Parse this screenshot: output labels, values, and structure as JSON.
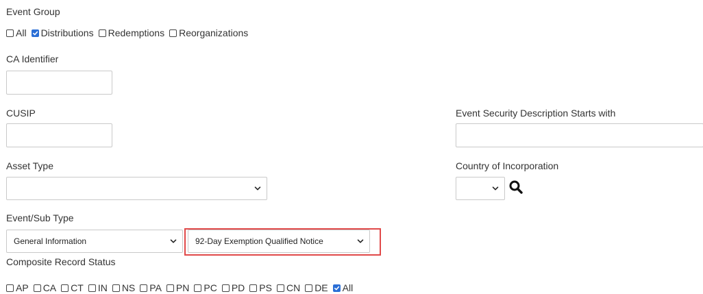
{
  "event_group": {
    "label": "Event Group",
    "options": [
      {
        "label": "All",
        "checked": false
      },
      {
        "label": "Distributions",
        "checked": true
      },
      {
        "label": "Redemptions",
        "checked": false
      },
      {
        "label": "Reorganizations",
        "checked": false
      }
    ]
  },
  "ca_identifier": {
    "label": "CA Identifier",
    "value": ""
  },
  "cusip": {
    "label": "CUSIP",
    "value": ""
  },
  "event_security_description": {
    "label": "Event Security Description Starts with",
    "value": ""
  },
  "asset_type": {
    "label": "Asset Type",
    "selected": ""
  },
  "country_of_incorporation": {
    "label": "Country of Incorporation",
    "selected": ""
  },
  "event_sub_type": {
    "label": "Event/Sub Type",
    "event_type_selected": "General Information",
    "sub_type_selected": "92-Day Exemption Qualified Notice"
  },
  "composite_record_status": {
    "label": "Composite Record Status",
    "options": [
      {
        "label": "AP",
        "checked": false
      },
      {
        "label": "CA",
        "checked": false
      },
      {
        "label": "CT",
        "checked": false
      },
      {
        "label": "IN",
        "checked": false
      },
      {
        "label": "NS",
        "checked": false
      },
      {
        "label": "PA",
        "checked": false
      },
      {
        "label": "PN",
        "checked": false
      },
      {
        "label": "PC",
        "checked": false
      },
      {
        "label": "PD",
        "checked": false
      },
      {
        "label": "PS",
        "checked": false
      },
      {
        "label": "CN",
        "checked": false
      },
      {
        "label": "DE",
        "checked": false
      },
      {
        "label": "All",
        "checked": true
      }
    ]
  },
  "colors": {
    "checkbox_checked": "#2b6fd6",
    "highlight_border": "#e04848",
    "text": "#333333",
    "input_border": "#c9c9c9"
  },
  "icons": {
    "country_lookup": "search-icon",
    "dropdown": "chevron-down-icon",
    "checkmark": "check-icon"
  }
}
